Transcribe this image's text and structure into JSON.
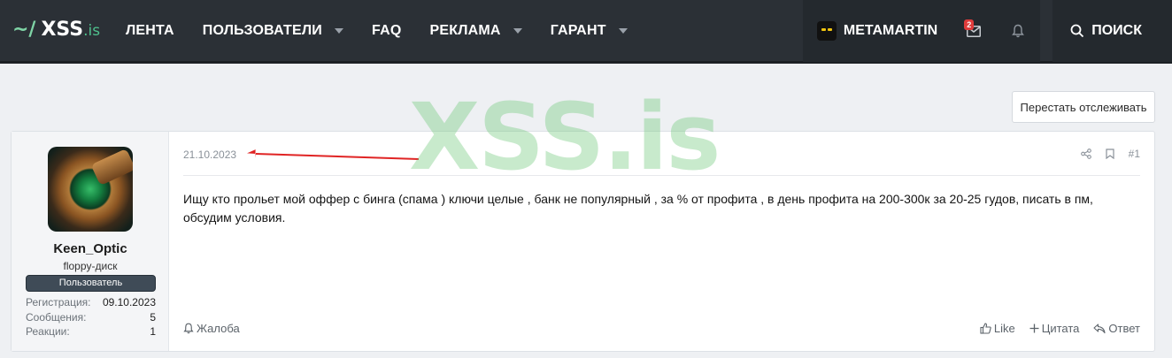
{
  "logo": {
    "tilde": "~/",
    "name": "XSS",
    "tld": ".is"
  },
  "nav": {
    "items": [
      {
        "label": "ЛЕНТА",
        "dropdown": false
      },
      {
        "label": "ПОЛЬЗОВАТЕЛИ",
        "dropdown": true
      },
      {
        "label": "FAQ",
        "dropdown": false
      },
      {
        "label": "РЕКЛАМА",
        "dropdown": true
      },
      {
        "label": "ГАРАНТ",
        "dropdown": true
      }
    ],
    "account_name": "METAMARTIN",
    "inbox_badge": "2",
    "search_label": "ПОИСК"
  },
  "watermark": "XSS.is",
  "unwatch_label": "Перестать отслеживать",
  "post": {
    "author": {
      "name": "Keen_Optic",
      "title": "floppy-диск",
      "banner": "Пользователь",
      "stats": [
        {
          "label": "Регистрация:",
          "value": "09.10.2023"
        },
        {
          "label": "Сообщения:",
          "value": "5"
        },
        {
          "label": "Реакции:",
          "value": "1"
        }
      ]
    },
    "date": "21.10.2023",
    "number": "#1",
    "body": "Ищу кто прольет мой оффер с бинга (спама ) ключи целые , банк не популярный , за % от профита , в день профита на 200-300к за 20-25 гудов, писать в пм, обсудим условия.",
    "report_label": "Жалоба",
    "like_label": "Like",
    "quote_label": "Цитата",
    "reply_label": "Ответ"
  },
  "colors": {
    "nav_bg": "#2b3036",
    "accent_green": "#4fc08d",
    "banner_bg": "#3f4b57",
    "annotation_arrow": "#e02424"
  }
}
